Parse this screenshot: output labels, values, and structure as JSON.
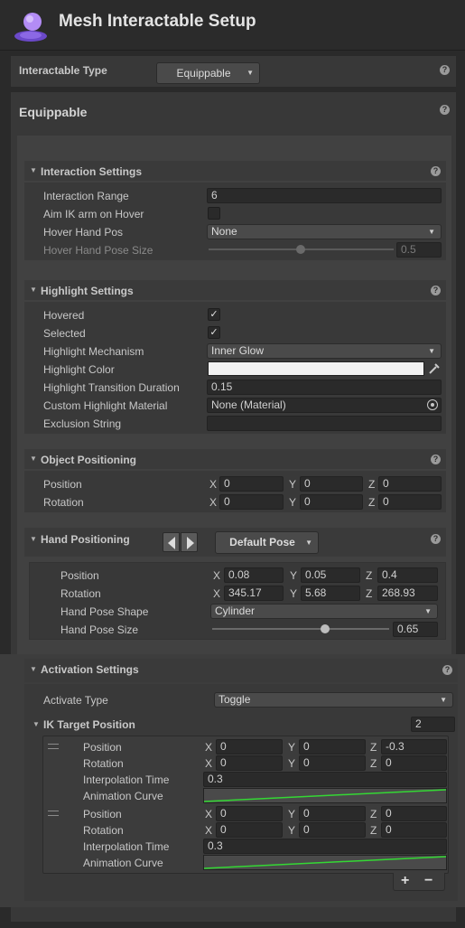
{
  "header": {
    "title": "Mesh Interactable Setup",
    "icon": "avatar-icon"
  },
  "interactable_type": {
    "label": "Interactable Type",
    "value": "Equippable"
  },
  "equippable": {
    "title": "Equippable"
  },
  "interaction": {
    "title": "Interaction Settings",
    "range_label": "Interaction Range",
    "range_value": "6",
    "aim_ik_label": "Aim IK arm on Hover",
    "aim_ik_checked": false,
    "hover_hand_pos_label": "Hover Hand Pos",
    "hover_hand_pos_value": "None",
    "hover_pose_size_label": "Hover Hand Pose Size",
    "hover_pose_size_value": "0.5",
    "hover_pose_size_slider": 0.5
  },
  "highlight": {
    "title": "Highlight Settings",
    "hovered_label": "Hovered",
    "hovered_checked": true,
    "selected_label": "Selected",
    "selected_checked": true,
    "mechanism_label": "Highlight Mechanism",
    "mechanism_value": "Inner Glow",
    "color_label": "Highlight Color",
    "color_value": "#f2f2f2",
    "duration_label": "Highlight Transition Duration",
    "duration_value": "0.15",
    "material_label": "Custom Highlight Material",
    "material_value": "None (Material)",
    "exclusion_label": "Exclusion String",
    "exclusion_value": ""
  },
  "object_positioning": {
    "title": "Object Positioning",
    "position_label": "Position",
    "position": {
      "x": "0",
      "y": "0",
      "z": "0"
    },
    "rotation_label": "Rotation",
    "rotation": {
      "x": "0",
      "y": "0",
      "z": "0"
    }
  },
  "hand_positioning": {
    "title": "Hand Positioning",
    "pose_value": "Default Pose",
    "position_label": "Position",
    "position": {
      "x": "0.08",
      "y": "0.05",
      "z": "0.4"
    },
    "rotation_label": "Rotation",
    "rotation": {
      "x": "345.17",
      "y": "5.68",
      "z": "268.93"
    },
    "shape_label": "Hand Pose Shape",
    "shape_value": "Cylinder",
    "size_label": "Hand Pose Size",
    "size_value": "0.65",
    "size_slider": 0.65
  },
  "activation": {
    "title": "Activation Settings",
    "type_label": "Activate Type",
    "type_value": "Toggle",
    "ik_title": "IK Target Position",
    "ik_count": "2",
    "items": [
      {
        "position_label": "Position",
        "position": {
          "x": "0",
          "y": "0",
          "z": "-0.3"
        },
        "rotation_label": "Rotation",
        "rotation": {
          "x": "0",
          "y": "0",
          "z": "0"
        },
        "interp_label": "Interpolation Time",
        "interp_value": "0.3",
        "curve_label": "Animation Curve"
      },
      {
        "position_label": "Position",
        "position": {
          "x": "0",
          "y": "0",
          "z": "0"
        },
        "rotation_label": "Rotation",
        "rotation": {
          "x": "0",
          "y": "0",
          "z": "0"
        },
        "interp_label": "Interpolation Time",
        "interp_value": "0.3",
        "curve_label": "Animation Curve"
      }
    ],
    "add_label": "+",
    "remove_label": "−"
  },
  "axis": {
    "x": "X",
    "y": "Y",
    "z": "Z"
  },
  "colors": {
    "accent_curve": "#34d834",
    "background": "#2a2a2a",
    "panel": "#383838"
  }
}
